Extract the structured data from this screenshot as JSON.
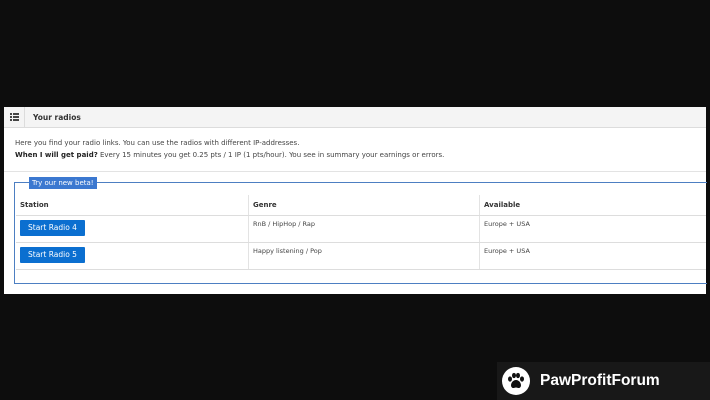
{
  "panel": {
    "title": "Your radios",
    "intro_line1": "Here you find your radio links. You can use the radios with different IP-addresses.",
    "intro_line2_bold": "When I will get paid?",
    "intro_line2_rest": " Every 15 minutes you get 0.25 pts / 1 IP (1 pts/hour). You see in summary your earnings or errors.",
    "menu_icon": "list-icon"
  },
  "beta": {
    "legend": "Try our new beta!"
  },
  "table": {
    "headers": [
      "Station",
      "Genre",
      "Available"
    ],
    "rows": [
      {
        "station": "Start Radio 4",
        "genre": "RnB / HipHop / Rap",
        "available": "Europe + USA"
      },
      {
        "station": "Start Radio 5",
        "genre": "Happy listening / Pop",
        "available": "Europe + USA"
      }
    ]
  },
  "watermark": {
    "text": "PawProfitForum",
    "icon": "paw-icon"
  },
  "colors": {
    "button": "#0b6fd0",
    "legend": "#3b78d0",
    "background": "#0d0d0d"
  }
}
